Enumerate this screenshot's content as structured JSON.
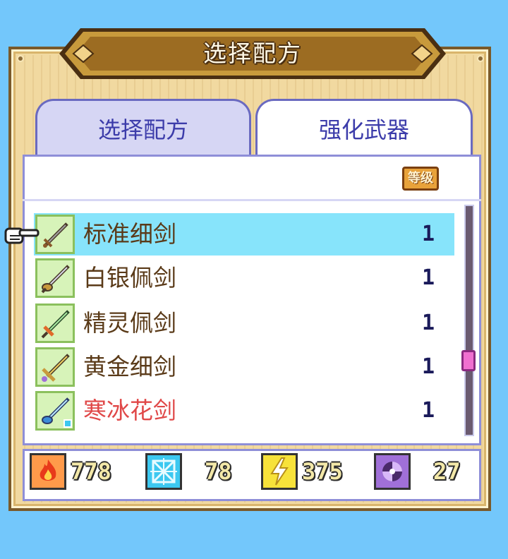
{
  "title": "选择配方",
  "tabs": [
    {
      "label": "选择配方",
      "active": false
    },
    {
      "label": "强化武器",
      "active": true
    }
  ],
  "column_header": "等级",
  "items": [
    {
      "name": "标准细剑",
      "level": "1",
      "selected": true,
      "rare": false
    },
    {
      "name": "白银佩剑",
      "level": "1",
      "selected": false,
      "rare": false
    },
    {
      "name": "精灵佩剑",
      "level": "1",
      "selected": false,
      "rare": false
    },
    {
      "name": "黄金细剑",
      "level": "1",
      "selected": false,
      "rare": false
    },
    {
      "name": "寒冰花剑",
      "level": "1",
      "selected": false,
      "rare": true
    }
  ],
  "scroll_position": 0.65,
  "resources": [
    {
      "icon": "fire-element-icon",
      "value": "778",
      "color": "#ff7a2a"
    },
    {
      "icon": "ice-element-icon",
      "value": "78",
      "color": "#3cc8f0"
    },
    {
      "icon": "lightning-element-icon",
      "value": "375",
      "color": "#f7e23a"
    },
    {
      "icon": "dark-element-icon",
      "value": "27",
      "color": "#a070d8"
    }
  ],
  "colors": {
    "background": "#73c7fb",
    "selected_row": "#87e4fb",
    "tab_text": "#3c3caa",
    "item_text": "#5a3a18",
    "rare_item_text": "#e04848"
  }
}
